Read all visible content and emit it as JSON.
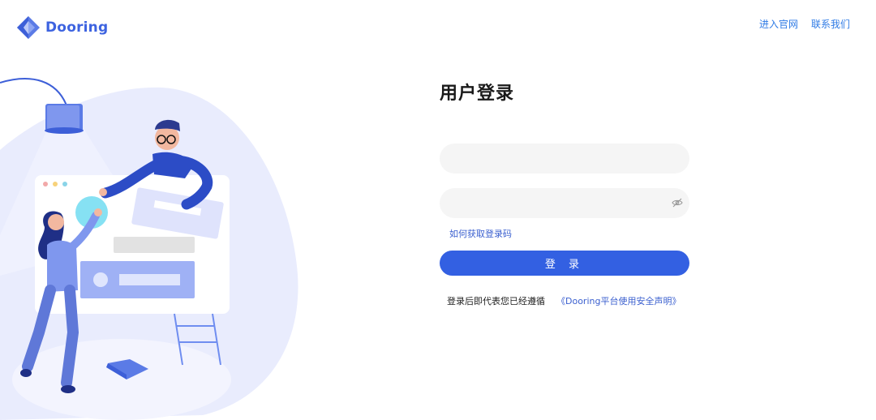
{
  "brand": {
    "name": "Dooring"
  },
  "nav": {
    "enter_site": "进入官网",
    "contact": "联系我们"
  },
  "login": {
    "title": "用户登录",
    "username": {
      "value": "",
      "placeholder": ""
    },
    "password": {
      "value": "",
      "placeholder": ""
    },
    "help_link": "如何获取登录码",
    "submit_label": "登 录",
    "agreement_text": "登录后即代表您已经遵循",
    "agreement_link": "《Dooring平台使用安全声明》"
  },
  "colors": {
    "primary": "#3360e2",
    "link": "#2f7be5",
    "illustration": "#e8ebfd"
  },
  "icons": {
    "logo": "diamond-logo-icon",
    "password_toggle": "eye-off-icon"
  }
}
